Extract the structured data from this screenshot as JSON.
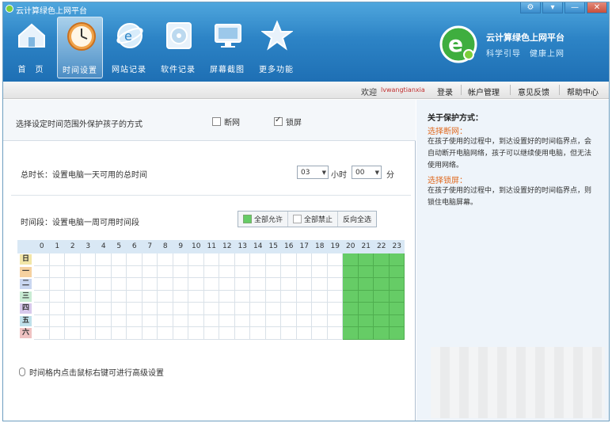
{
  "window": {
    "title": "云计算绿色上网平台",
    "controls": [
      "⚙",
      "▾",
      "—",
      "✕"
    ]
  },
  "nav": {
    "items": [
      {
        "label": "首　页",
        "icon": "home-icon"
      },
      {
        "label": "时间设置",
        "icon": "clock-icon",
        "active": true
      },
      {
        "label": "网站记录",
        "icon": "web-icon"
      },
      {
        "label": "软件记录",
        "icon": "disc-icon"
      },
      {
        "label": "屏幕截图",
        "icon": "monitor-icon"
      },
      {
        "label": "更多功能",
        "icon": "star-icon"
      }
    ]
  },
  "brand": {
    "title": "云计算绿色上网平台",
    "subtitle": "科学引导　健康上网"
  },
  "linkbar": {
    "welcome": "欢迎",
    "username": "lvwangtianxia",
    "login": "登录",
    "account": "帐户管理",
    "feedback": "意见反馈",
    "help": "帮助中心"
  },
  "protect": {
    "label": "选择设定时间范围外保护孩子的方式",
    "option_disconnect": "断网",
    "option_lock": "锁屏",
    "disconnect_checked": false,
    "lock_checked": true
  },
  "duration": {
    "label": "总时长：设置电脑一天可用的总时间",
    "hours": "03",
    "hours_unit": "小时",
    "minutes": "00",
    "minutes_unit": "分"
  },
  "period": {
    "label": "时间段：设置电脑一周可用时间段",
    "allow_all": "全部允许",
    "forbid_all": "全部禁止",
    "invert": "反向全选"
  },
  "grid": {
    "hours": [
      "0",
      "1",
      "2",
      "3",
      "4",
      "5",
      "6",
      "7",
      "8",
      "9",
      "10",
      "11",
      "12",
      "13",
      "14",
      "15",
      "16",
      "17",
      "18",
      "19",
      "20",
      "21",
      "22",
      "23"
    ],
    "days": [
      {
        "label": "日",
        "color": "#f2e6a8"
      },
      {
        "label": "一",
        "color": "#f5d1a0"
      },
      {
        "label": "二",
        "color": "#c9d6f0"
      },
      {
        "label": "三",
        "color": "#c9ecd4"
      },
      {
        "label": "四",
        "color": "#d8c9ec"
      },
      {
        "label": "五",
        "color": "#bfe0ea"
      },
      {
        "label": "六",
        "color": "#efc2c2"
      }
    ],
    "allowed_hours": [
      20,
      21,
      22,
      23
    ],
    "allowed_color": "#66cc66"
  },
  "hint": {
    "text": "时间格内点击鼠标右键可进行高级设置"
  },
  "side": {
    "title": "关于保护方式：",
    "disconnect_title": "选择断网：",
    "disconnect_text": "在孩子使用的过程中，到达设置好的时间临界点，会自动断开电脑网络，孩子可以继续使用电脑，但无法使用网络。",
    "lock_title": "选择锁屏：",
    "lock_text": "在孩子使用的过程中，到达设置好的时间临界点，则锁住电脑屏幕。"
  }
}
